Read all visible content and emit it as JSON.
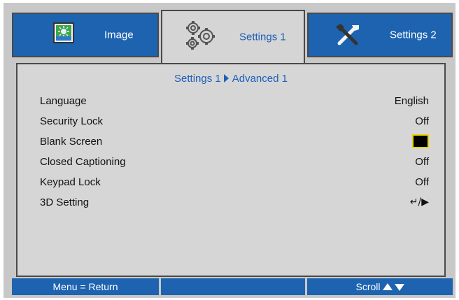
{
  "tabs": [
    {
      "label": "Image",
      "icon": "image-icon",
      "active": false
    },
    {
      "label": "Settings 1",
      "icon": "gears-icon",
      "active": true
    },
    {
      "label": "Settings 2",
      "icon": "tools-icon",
      "active": false
    }
  ],
  "breadcrumb": {
    "parent": "Settings 1",
    "current": "Advanced 1"
  },
  "menu_items": [
    {
      "label": "Language",
      "value": "English"
    },
    {
      "label": "Security Lock",
      "value": "Off"
    },
    {
      "label": "Blank Screen",
      "value_color": "#000000"
    },
    {
      "label": "Closed Captioning",
      "value": "Off"
    },
    {
      "label": "Keypad Lock",
      "value": "Off"
    },
    {
      "label": "3D Setting",
      "value": "↵/▶"
    }
  ],
  "footer": {
    "left": "Menu = Return",
    "right": "Scroll"
  },
  "colors": {
    "accent_blue": "#1d63b0",
    "highlight_yellow": "#e8d400"
  }
}
